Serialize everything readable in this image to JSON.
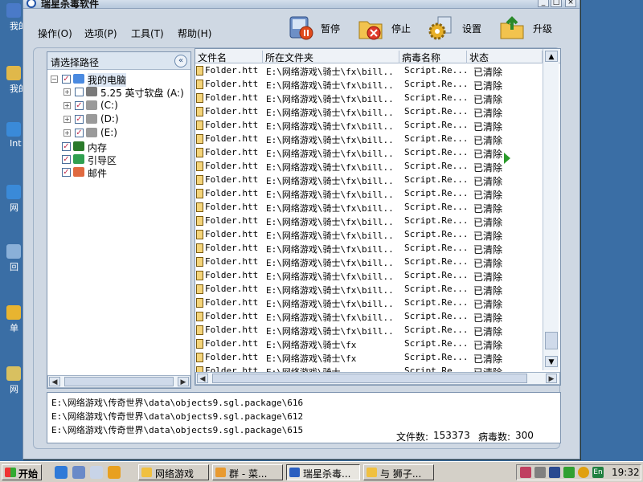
{
  "desktop": {
    "icons": [
      {
        "label": "我的",
        "color": "#4a7ac8"
      },
      {
        "label": "我的",
        "color": "#e0b84a"
      },
      {
        "label": "Int Exp",
        "color": "#3a8ad8"
      },
      {
        "label": "网",
        "color": "#3a8ad8"
      },
      {
        "label": "回",
        "color": "#8ab0d8"
      },
      {
        "label": "单",
        "color": "#e8b430"
      },
      {
        "label": "网",
        "color": "#d8c060"
      }
    ]
  },
  "window": {
    "title": "瑞星杀毒软件",
    "minimize": "_",
    "maximize": "□",
    "close": "×"
  },
  "menu": {
    "items": [
      "操作(O)",
      "选项(P)",
      "工具(T)",
      "帮助(H)"
    ]
  },
  "toolbar": {
    "buttons": [
      {
        "label": "暂停",
        "icon": "pause-icon"
      },
      {
        "label": "停止",
        "icon": "stop-icon"
      },
      {
        "label": "设置",
        "icon": "settings-gear-icon"
      },
      {
        "label": "升级",
        "icon": "upgrade-icon"
      }
    ]
  },
  "tree": {
    "header": "请选择路径",
    "collapse_icon": "«",
    "nodes": [
      {
        "label": "我的电脑",
        "exp": "−",
        "checked": true,
        "icon": "computer-icon",
        "highlight": true
      },
      {
        "label": "5.25 英寸软盘 (A:)",
        "exp": "+",
        "checked": false,
        "icon": "floppy-icon"
      },
      {
        "label": "(C:)",
        "exp": "+",
        "checked": true,
        "icon": "drive-icon"
      },
      {
        "label": "(D:)",
        "exp": "+",
        "checked": true,
        "icon": "drive-icon"
      },
      {
        "label": "(E:)",
        "exp": "+",
        "checked": true,
        "icon": "drive-icon"
      },
      {
        "label": "内存",
        "checked": true,
        "icon": "memory-icon"
      },
      {
        "label": "引导区",
        "checked": true,
        "icon": "boot-sector-icon"
      },
      {
        "label": "邮件",
        "checked": true,
        "icon": "mail-icon"
      }
    ]
  },
  "list": {
    "columns": [
      "文件名",
      "所在文件夹",
      "病毒名称",
      "状态"
    ],
    "rows": [
      {
        "file": "Folder.htt",
        "folder": "E:\\网络游戏\\骑士\\fx\\bill..",
        "virus": "Script.Re...",
        "status": "已清除"
      },
      {
        "file": "Folder.htt",
        "folder": "E:\\网络游戏\\骑士\\fx\\bill..",
        "virus": "Script.Re...",
        "status": "已清除"
      },
      {
        "file": "Folder.htt",
        "folder": "E:\\网络游戏\\骑士\\fx\\bill..",
        "virus": "Script.Re...",
        "status": "已清除"
      },
      {
        "file": "Folder.htt",
        "folder": "E:\\网络游戏\\骑士\\fx\\bill..",
        "virus": "Script.Re...",
        "status": "已清除"
      },
      {
        "file": "Folder.htt",
        "folder": "E:\\网络游戏\\骑士\\fx\\bill..",
        "virus": "Script.Re...",
        "status": "已清除"
      },
      {
        "file": "Folder.htt",
        "folder": "E:\\网络游戏\\骑士\\fx\\bill..",
        "virus": "Script.Re...",
        "status": "已清除"
      },
      {
        "file": "Folder.htt",
        "folder": "E:\\网络游戏\\骑士\\fx\\bill..",
        "virus": "Script.Re...",
        "status": "已清除"
      },
      {
        "file": "Folder.htt",
        "folder": "E:\\网络游戏\\骑士\\fx\\bill..",
        "virus": "Script.Re...",
        "status": "已清除"
      },
      {
        "file": "Folder.htt",
        "folder": "E:\\网络游戏\\骑士\\fx\\bill..",
        "virus": "Script.Re...",
        "status": "已清除"
      },
      {
        "file": "Folder.htt",
        "folder": "E:\\网络游戏\\骑士\\fx\\bill..",
        "virus": "Script.Re...",
        "status": "已清除"
      },
      {
        "file": "Folder.htt",
        "folder": "E:\\网络游戏\\骑士\\fx\\bill..",
        "virus": "Script.Re...",
        "status": "已清除"
      },
      {
        "file": "Folder.htt",
        "folder": "E:\\网络游戏\\骑士\\fx\\bill..",
        "virus": "Script.Re...",
        "status": "已清除"
      },
      {
        "file": "Folder.htt",
        "folder": "E:\\网络游戏\\骑士\\fx\\bill..",
        "virus": "Script.Re...",
        "status": "已清除"
      },
      {
        "file": "Folder.htt",
        "folder": "E:\\网络游戏\\骑士\\fx\\bill..",
        "virus": "Script.Re...",
        "status": "已清除"
      },
      {
        "file": "Folder.htt",
        "folder": "E:\\网络游戏\\骑士\\fx\\bill..",
        "virus": "Script.Re...",
        "status": "已清除"
      },
      {
        "file": "Folder.htt",
        "folder": "E:\\网络游戏\\骑士\\fx\\bill..",
        "virus": "Script.Re...",
        "status": "已清除"
      },
      {
        "file": "Folder.htt",
        "folder": "E:\\网络游戏\\骑士\\fx\\bill..",
        "virus": "Script.Re...",
        "status": "已清除"
      },
      {
        "file": "Folder.htt",
        "folder": "E:\\网络游戏\\骑士\\fx\\bill..",
        "virus": "Script.Re...",
        "status": "已清除"
      },
      {
        "file": "Folder.htt",
        "folder": "E:\\网络游戏\\骑士\\fx\\bill..",
        "virus": "Script.Re...",
        "status": "已清除"
      },
      {
        "file": "Folder.htt",
        "folder": "E:\\网络游戏\\骑士\\fx\\bill..",
        "virus": "Script.Re...",
        "status": "已清除"
      },
      {
        "file": "Folder.htt",
        "folder": "E:\\网络游戏\\骑士\\fx",
        "virus": "Script.Re...",
        "status": "已清除"
      },
      {
        "file": "Folder.htt",
        "folder": "E:\\网络游戏\\骑士\\fx",
        "virus": "Script.Re...",
        "status": "已清除"
      },
      {
        "file": "Folder.htt",
        "folder": "E:\\网络游戏\\骑士",
        "virus": "Script.Re...",
        "status": "已清除"
      }
    ]
  },
  "log": {
    "lines": [
      "E:\\网络游戏\\传奇世界\\data\\objects9.sgl.package\\616",
      "E:\\网络游戏\\传奇世界\\data\\objects9.sgl.package\\612",
      "E:\\网络游戏\\传奇世界\\data\\objects9.sgl.package\\615"
    ],
    "file_count_label": "文件数:",
    "file_count": "153373",
    "virus_count_label": "病毒数:",
    "virus_count": "300"
  },
  "taskbar": {
    "start": "开始",
    "tasks": [
      {
        "label": "网络游戏",
        "icon": "folder-icon",
        "color": "#f0c040"
      },
      {
        "label": "群 - 菜...",
        "icon": "chat-icon",
        "color": "#e89a30"
      },
      {
        "label": "瑞星杀毒...",
        "icon": "rising-antivirus-icon",
        "color": "#2b5fc0",
        "active": true
      },
      {
        "label": "与 狮子...",
        "icon": "message-icon",
        "color": "#f0c040"
      }
    ],
    "clock": "19:32",
    "lang": "En"
  }
}
